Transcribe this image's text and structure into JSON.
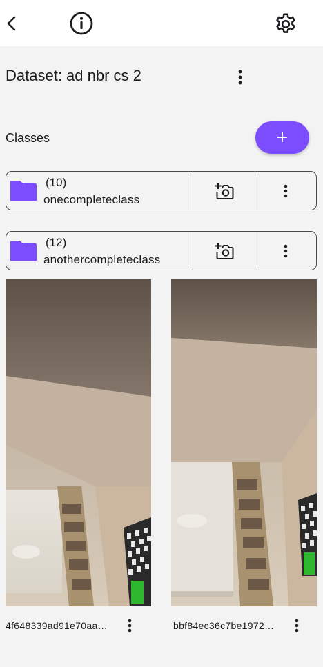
{
  "header": {
    "back_icon": "arrow-back-icon",
    "info_icon": "info-icon",
    "settings_icon": "gear-icon"
  },
  "dataset": {
    "title": "Dataset: ad nbr cs 2"
  },
  "classes_section": {
    "label": "Classes",
    "add_button_label": "+",
    "accent_color": "#7c4dff"
  },
  "classes": [
    {
      "count": "(10)",
      "name": "onecompleteclass"
    },
    {
      "count": "(12)",
      "name": "anothercompleteclass"
    }
  ],
  "images": [
    {
      "label": "4f648339ad91e70aa…"
    },
    {
      "label": "bbf84ec36c7be1972…"
    }
  ]
}
